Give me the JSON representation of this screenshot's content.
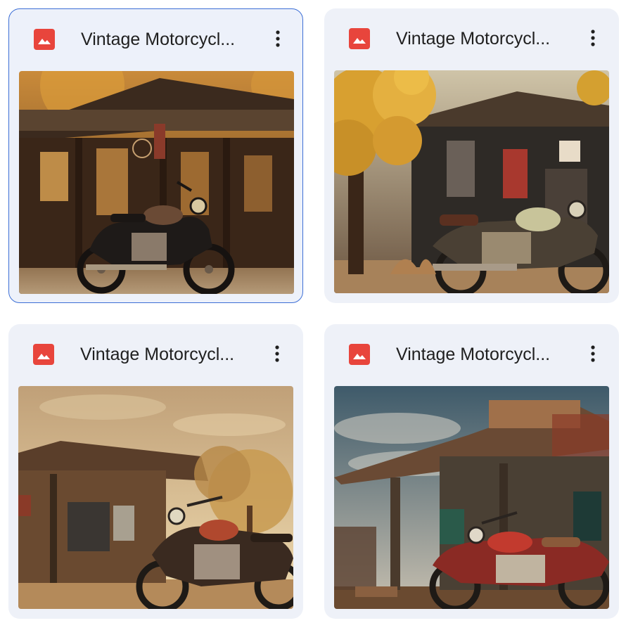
{
  "cards": [
    {
      "title": "Vintage Motorcycl...",
      "icon": "image-file-icon",
      "more_icon": "more-vert-icon",
      "selected": true
    },
    {
      "title": "Vintage Motorcycl...",
      "icon": "image-file-icon",
      "more_icon": "more-vert-icon",
      "selected": false
    },
    {
      "title": "Vintage Motorcycl...",
      "icon": "image-file-icon",
      "more_icon": "more-vert-icon",
      "selected": false
    },
    {
      "title": "Vintage Motorcycl...",
      "icon": "image-file-icon",
      "more_icon": "more-vert-icon",
      "selected": false
    }
  ],
  "colors": {
    "icon_red": "#e8453c",
    "card_bg": "#eef1f8",
    "selected_border": "#3d6fd6",
    "title_text": "#1f1f1f"
  }
}
